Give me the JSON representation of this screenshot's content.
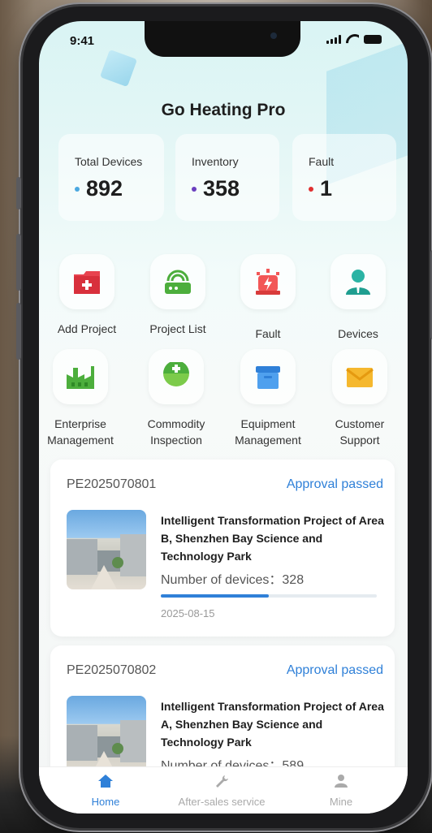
{
  "status_bar": {
    "time": "9:41"
  },
  "app": {
    "title": "Go Heating Pro"
  },
  "stats": [
    {
      "label": "Total  Devices",
      "value": "892",
      "dot_color": "#4aa8e0"
    },
    {
      "label": "Inventory",
      "value": "358",
      "dot_color": "#6a3fbf"
    },
    {
      "label": "Fault",
      "value": "1",
      "dot_color": "#e03030"
    }
  ],
  "menu": [
    {
      "label": "Add  Project",
      "icon": "add-project-icon"
    },
    {
      "label": "Project List",
      "icon": "project-list-icon"
    },
    {
      "label": "Fault",
      "icon": "fault-icon"
    },
    {
      "label": "Devices",
      "icon": "devices-icon"
    },
    {
      "label": "Enterprise Management",
      "icon": "enterprise-icon"
    },
    {
      "label": "Commodity Inspection",
      "icon": "inspection-icon"
    },
    {
      "label": "Equipment Management",
      "icon": "equipment-icon"
    },
    {
      "label": "Customer Support",
      "icon": "support-icon"
    }
  ],
  "projects": [
    {
      "id": "PE2025070801",
      "status": "Approval passed",
      "title": "Intelligent Transformation Project of Area B, Shenzhen Bay Science and Technology Park",
      "devices": "Number of devices：328",
      "progress": 0.5,
      "date": "2025-08-15"
    },
    {
      "id": "PE2025070802",
      "status": "Approval passed",
      "title": "Intelligent Transformation Project of Area A, Shenzhen Bay Science and Technology Park",
      "devices": "Number of devices：589"
    }
  ],
  "tabs": [
    {
      "label": "Home",
      "active": true
    },
    {
      "label": "After-sales service",
      "active": false
    },
    {
      "label": "Mine",
      "active": false
    }
  ],
  "colors": {
    "accent": "#2f80d8",
    "fault": "#e04040",
    "green": "#4cae3c"
  }
}
